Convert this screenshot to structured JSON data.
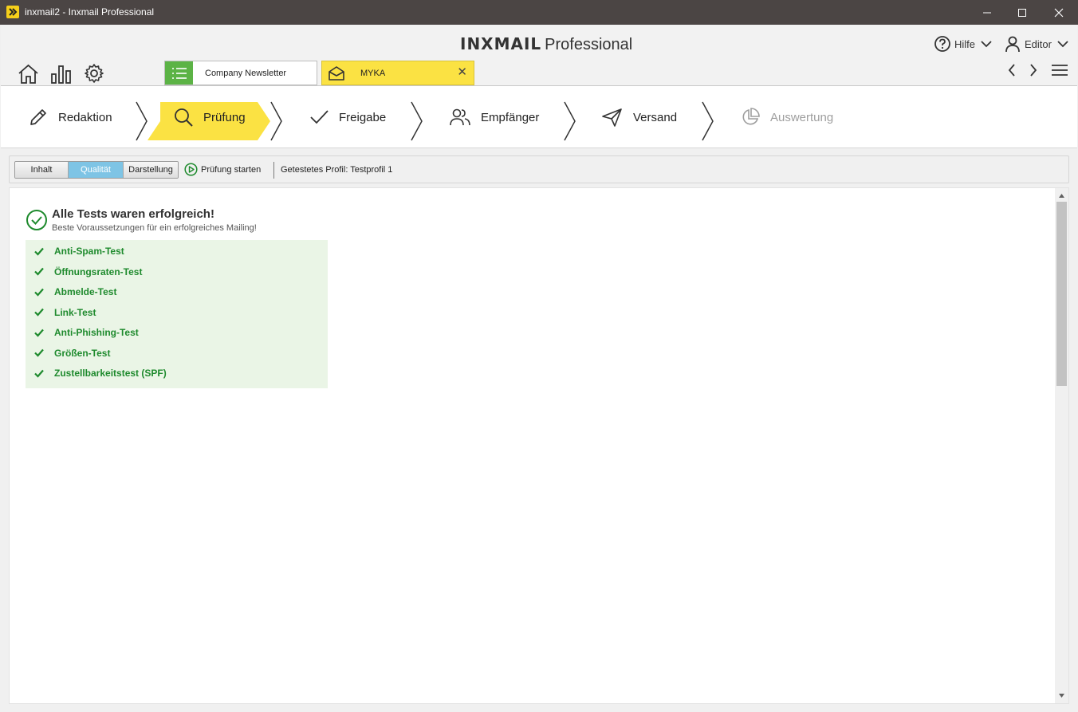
{
  "window": {
    "title": "inxmail2 - Inxmail Professional"
  },
  "header": {
    "brand_logo": "INXMAIL",
    "brand_product": "Professional",
    "help_label": "Hilfe",
    "user_label": "Editor"
  },
  "tabs": [
    {
      "label": "Company Newsletter",
      "icon": "list-icon",
      "accent": "#5cb346",
      "active": false
    },
    {
      "label": "MYKA",
      "icon": "envelope-icon",
      "accent": "#fbe243",
      "active": true,
      "closable": true,
      "close_glyph": "✕"
    }
  ],
  "workflow": {
    "steps": [
      {
        "label": "Redaktion",
        "icon": "pencil-icon",
        "state": "normal"
      },
      {
        "label": "Prüfung",
        "icon": "search-icon",
        "state": "active"
      },
      {
        "label": "Freigabe",
        "icon": "check-icon",
        "state": "normal"
      },
      {
        "label": "Empfänger",
        "icon": "users-icon",
        "state": "normal"
      },
      {
        "label": "Versand",
        "icon": "send-icon",
        "state": "normal"
      },
      {
        "label": "Auswertung",
        "icon": "pie-chart-icon",
        "state": "disabled"
      }
    ],
    "active_color": "#fbe243"
  },
  "toolbar": {
    "segments": [
      "Inhalt",
      "Qualität",
      "Darstellung"
    ],
    "selected_segment": "Qualität",
    "start_label": "Prüfung starten",
    "profile_text": "Getestetes Profil: Testprofil 1"
  },
  "result": {
    "title": "Alle Tests waren erfolgreich!",
    "subtitle": "Beste Voraussetzungen für ein erfolgreiches Mailing!",
    "success_color": "#1e8a2d",
    "tests": [
      "Anti-Spam-Test",
      "Öffnungsraten-Test",
      "Abmelde-Test",
      "Link-Test",
      "Anti-Phishing-Test",
      "Größen-Test",
      "Zustellbarkeitstest (SPF)"
    ]
  }
}
